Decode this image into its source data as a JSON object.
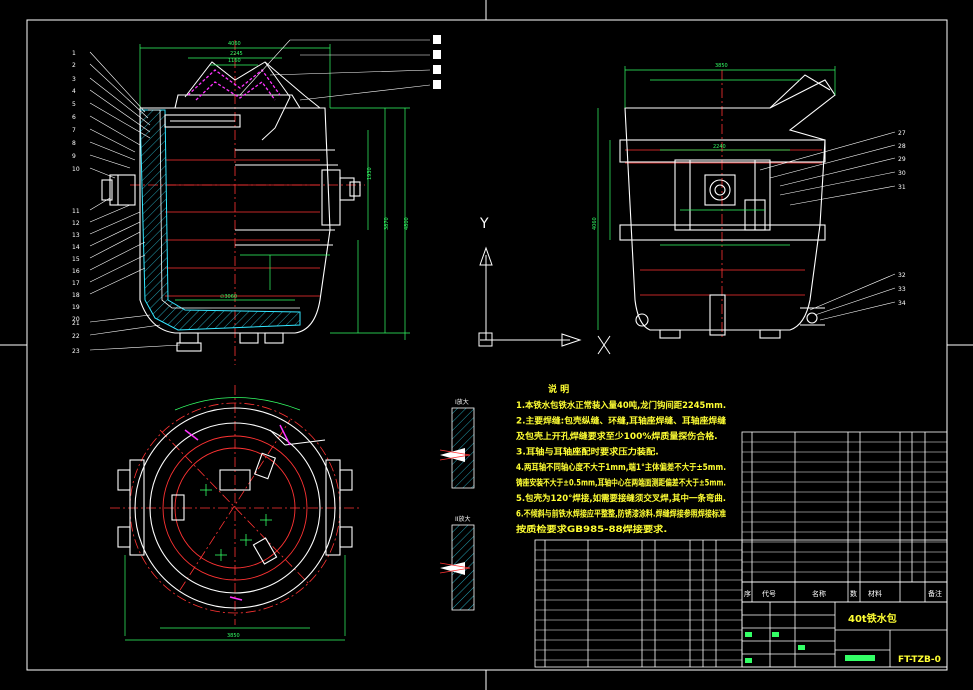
{
  "colors": {
    "background": "#000000",
    "frame": "#ffffff",
    "outline": "#ffffff",
    "dimension": "#33ff66",
    "center_line": "#ff3333",
    "hatch": "#33e6ff",
    "nozzle": "#ff33ff",
    "text": "#ffff33"
  },
  "axis_icon": {
    "y_label": "Y",
    "x_label": "X"
  },
  "callouts_left": [
    "1",
    "2",
    "3",
    "4",
    "5",
    "6",
    "7",
    "8",
    "9",
    "10",
    "11",
    "12",
    "13",
    "14",
    "15",
    "16",
    "17",
    "18",
    "19",
    "20",
    "21",
    "22",
    "23"
  ],
  "callouts_right": [
    "27",
    "28",
    "29",
    "30",
    "31",
    "32",
    "33",
    "34"
  ],
  "notes": {
    "title": "说  明",
    "lines": [
      "1.本铁水包铁水正常装入量40吨,龙门钩间距2245mm.",
      "2.主要焊缝:包壳纵缝、环缝,耳轴座焊缝、耳轴座焊缝",
      "及包壳上开孔焊缝要求至少100%焊质量探伤合格.",
      "3.耳轴与耳轴座配时要求压力装配.",
      "4.两耳轴不同轴心度不大于1mm,端1°主体偏差不大于±5mm.",
      "铸座安装不大于±0.5mm,耳轴中心在两端面测距偏差不大于±5mm.",
      "5.包壳为120°焊接,如需要接缝须交叉焊,其中一条弯曲.",
      "6.不倾斜与前铁水焊接应平整整,防锈漆涂料.焊缝焊接参照焊接标准",
      "按质检要求GB985-88焊接要求."
    ]
  },
  "section_labels": [
    "I放大",
    "II放大"
  ],
  "title_block": {
    "title": "40t铁水包",
    "drawing_no": "FT-TZB-0",
    "header": [
      "序",
      "代号",
      "名称",
      "数",
      "材料",
      "备注"
    ]
  },
  "dimensions": [
    "4060",
    "3870",
    "2245",
    "2240",
    "1930",
    "1160",
    "∅3060",
    "4800",
    "∅3850"
  ]
}
